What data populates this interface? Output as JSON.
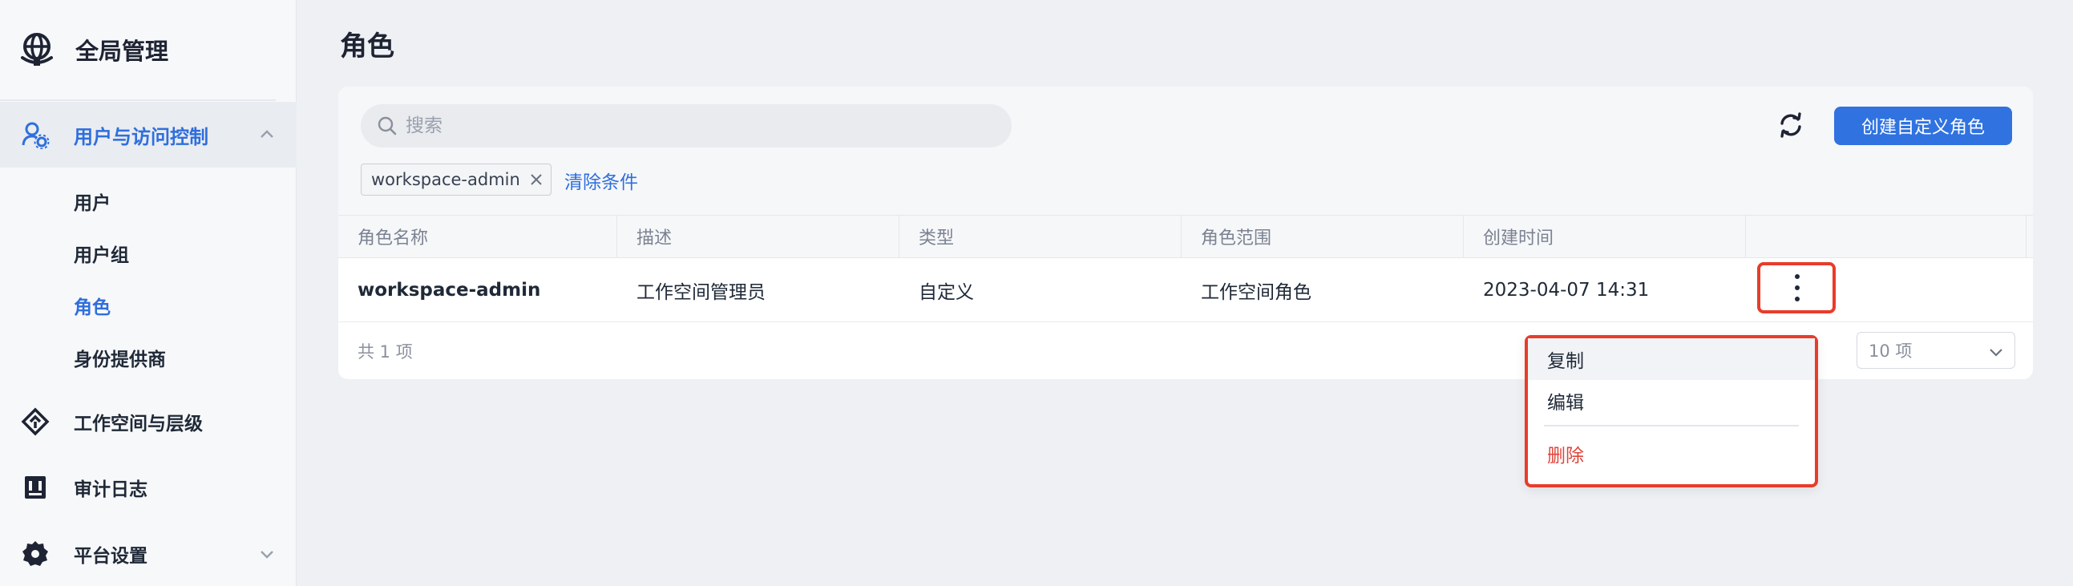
{
  "sidebar": {
    "brand": "全局管理",
    "group": {
      "label": "用户与访问控制",
      "expanded": true
    },
    "sub_items": [
      "用户",
      "用户组",
      "角色",
      "身份提供商"
    ],
    "active_sub_item": "角色",
    "items": [
      {
        "label": "工作空间与层级",
        "icon": "workspace-diamond-icon"
      },
      {
        "label": "审计日志",
        "icon": "audit-log-icon"
      },
      {
        "label": "平台设置",
        "icon": "gear-icon",
        "has_chevron": true
      }
    ]
  },
  "page": {
    "title": "角色"
  },
  "toolbar": {
    "search_placeholder": "搜索",
    "create_button": "创建自定义角色",
    "filter_chip": "workspace-admin",
    "clear_filters": "清除条件"
  },
  "table": {
    "columns": [
      "角色名称",
      "描述",
      "类型",
      "角色范围",
      "创建时间"
    ],
    "rows": [
      {
        "name": "workspace-admin",
        "description": "工作空间管理员",
        "type": "自定义",
        "scope": "工作空间角色",
        "created": "2023-04-07 14:31"
      }
    ],
    "total": "共 1 项",
    "page_size": "10 项"
  },
  "row_menu": {
    "items": [
      "复制",
      "编辑",
      "删除"
    ],
    "hovered_item": "复制",
    "danger_item": "删除"
  },
  "colors": {
    "accent": "#3072e0",
    "highlight_box": "#e83c2a",
    "danger": "#e0443a"
  }
}
